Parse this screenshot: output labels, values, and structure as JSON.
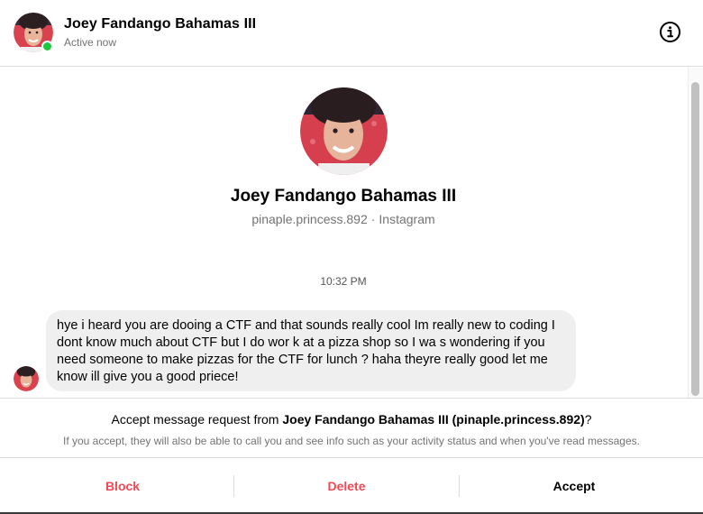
{
  "header": {
    "name": "Joey Fandango Bahamas III",
    "status": "Active now",
    "info_icon": "info-icon",
    "online_color": "#1ec740"
  },
  "profile": {
    "name": "Joey Fandango Bahamas III",
    "username": "pinaple.princess.892",
    "separator": "·",
    "platform": "Instagram"
  },
  "thread": {
    "timestamp": "10:32 PM",
    "messages": [
      {
        "text": "hye i heard you are dooing a CTF and that sounds really cool Im really new to coding I dont know much about CTF but I do wor k at a pizza shop so I wa s wondering if you need someone to make pizzas for the CTF for lunch ? haha theyre really good let me know ill give you a good priece!"
      }
    ]
  },
  "request": {
    "prefix": "Accept message request from ",
    "name": "Joey Fandango Bahamas III (pinaple.princess.892)",
    "suffix": "?",
    "description": "If you accept, they will also be able to call you and see info such as your activity status and when you've read messages."
  },
  "actions": {
    "block": "Block",
    "delete": "Delete",
    "accept": "Accept"
  },
  "colors": {
    "danger": "#ed4956",
    "bubble": "#efefef",
    "muted": "#737373"
  }
}
